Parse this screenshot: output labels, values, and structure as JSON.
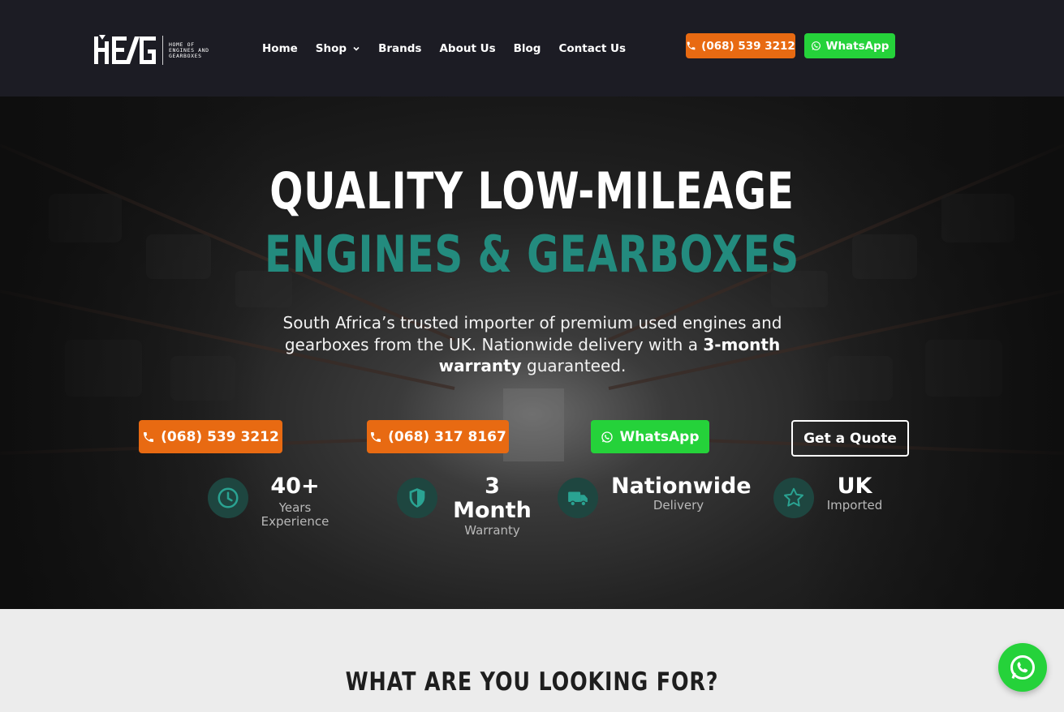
{
  "header": {
    "logo": {
      "mark": "HE/G",
      "line1": "HOME OF",
      "line2": "ENGINES AND",
      "line3": "GEARBOXES"
    },
    "nav": [
      {
        "label": "Home"
      },
      {
        "label": "Shop",
        "has_dropdown": true
      },
      {
        "label": "Brands"
      },
      {
        "label": "About Us"
      },
      {
        "label": "Blog"
      },
      {
        "label": "Contact Us"
      }
    ],
    "phone_button": "(068) 539 3212",
    "whatsapp_button": "WhatsApp"
  },
  "hero": {
    "title_line1": "QUALITY LOW-MILEAGE",
    "title_line2": "ENGINES & GEARBOXES",
    "subtitle_part1": "South Africa’s trusted importer of premium used engines and gearboxes from the UK. Nationwide delivery with a ",
    "subtitle_bold": "3-month warranty",
    "subtitle_part2": " guaranteed.",
    "cta": {
      "phone1": "(068) 539 3212",
      "phone2": "(068) 317 8167",
      "whatsapp": "WhatsApp",
      "quote": "Get a Quote"
    },
    "stats": [
      {
        "value": "40+",
        "label": "Years Experience",
        "icon": "clock-icon"
      },
      {
        "value": "3 Month",
        "label": "Warranty",
        "icon": "shield-icon"
      },
      {
        "value": "Nationwide",
        "label": "Delivery",
        "icon": "truck-icon"
      },
      {
        "value": "UK",
        "label": "Imported",
        "icon": "star-icon"
      }
    ]
  },
  "section": {
    "title": "WHAT ARE YOU LOOKING FOR?"
  },
  "colors": {
    "accent_teal": "#238b7e",
    "orange": "#e86a12",
    "whatsapp_green": "#25d23a",
    "header_bg": "#1c1c24"
  }
}
